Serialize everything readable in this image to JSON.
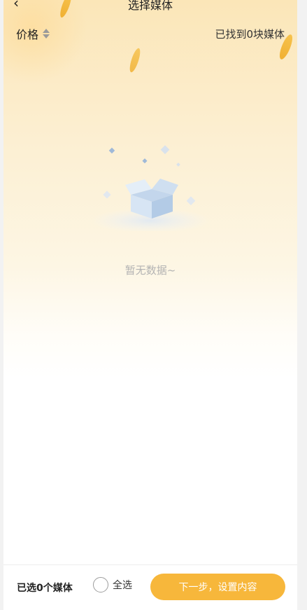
{
  "header": {
    "title": "选择媒体",
    "back_icon": "chevron-left-icon",
    "back_glyph": "‹"
  },
  "filter": {
    "price_label": "价格",
    "sort_icon": "sort-updown-icon",
    "found_text": "已找到0块媒体"
  },
  "empty_state": {
    "illustration": "empty-box-icon",
    "text": "暂无数据~"
  },
  "footer": {
    "selected_text": "已选0个媒体",
    "select_all_label": "全选",
    "next_button_label": "下一步，设置内容"
  },
  "colors": {
    "accent": "#f7b73b",
    "header_gradient_top": "#fbe6b8",
    "text_primary": "#222222",
    "text_muted": "#b3b3b3"
  }
}
